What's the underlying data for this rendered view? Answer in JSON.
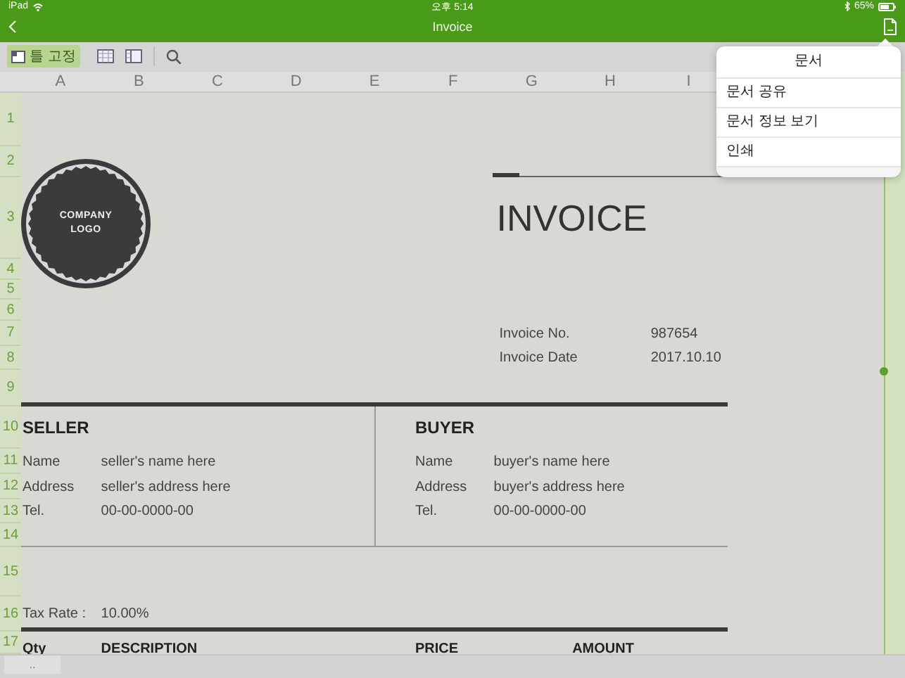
{
  "status_bar": {
    "device": "iPad",
    "time": "오후 5:14",
    "battery": "65%"
  },
  "nav": {
    "title": "Invoice"
  },
  "toolbar": {
    "freeze_button": {
      "label": "틀 고정",
      "selected": true
    }
  },
  "sheet": {
    "columns": [
      "A",
      "B",
      "C",
      "D",
      "E",
      "F",
      "G",
      "H",
      "I"
    ],
    "rows": [
      "1",
      "2",
      "3",
      "4",
      "5",
      "6",
      "7",
      "8",
      "9",
      "10",
      "11",
      "12",
      "13",
      "14",
      "15",
      "16",
      "17"
    ],
    "logo_text": "COMPANY LOGO",
    "title": "INVOICE",
    "meta": [
      {
        "label": "Invoice No.",
        "value": "987654"
      },
      {
        "label": "Invoice Date",
        "value": "2017.10.10"
      }
    ],
    "parties": [
      {
        "heading": "SELLER",
        "fields": [
          {
            "label": "Name",
            "value": "seller's name here"
          },
          {
            "label": "Address",
            "value": "seller's address here"
          },
          {
            "label": "Tel.",
            "value": "00-00-0000-00"
          }
        ]
      },
      {
        "heading": "BUYER",
        "fields": [
          {
            "label": "Name",
            "value": "buyer's name here"
          },
          {
            "label": "Address",
            "value": "buyer's address here"
          },
          {
            "label": "Tel.",
            "value": "00-00-0000-00"
          }
        ]
      }
    ],
    "tax": {
      "label": "Tax Rate :",
      "value": "10.00%"
    },
    "item_columns": [
      "Qty",
      "DESCRIPTION",
      "PRICE",
      "AMOUNT"
    ]
  },
  "menu": {
    "title": "문서",
    "items": [
      "문서 공유",
      "문서 정보 보기",
      "인쇄"
    ]
  },
  "bottom_bar": {
    "tab": ".."
  }
}
